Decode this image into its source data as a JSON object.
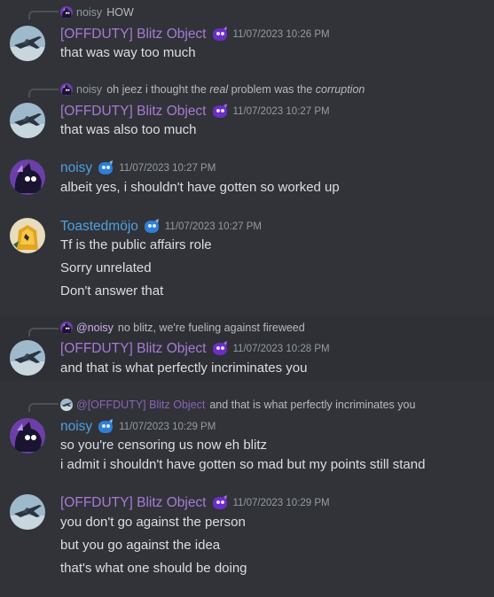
{
  "users": {
    "blitz": "[OFFDUTY] Blitz Object",
    "noisy": "noisy",
    "toast": "Toastedmöjo"
  },
  "messages": [
    {
      "reply": {
        "name": "noisy",
        "text": "HOW"
      },
      "author": "[OFFDUTY] Blitz Object",
      "timestamp": "11/07/2023 10:26 PM",
      "lines": [
        "that was way too much"
      ]
    },
    {
      "reply": {
        "name": "noisy",
        "text_pre": "oh jeez i thought the ",
        "text_em": "real",
        "text_mid": " problem was the ",
        "text_em2": "corruption"
      },
      "author": "[OFFDUTY] Blitz Object",
      "timestamp": "11/07/2023 10:27 PM",
      "lines": [
        "that was also too much"
      ]
    },
    {
      "author": "noisy",
      "timestamp": "11/07/2023 10:27 PM",
      "lines": [
        "albeit yes, i shouldn't have gotten so worked up"
      ]
    },
    {
      "author": "Toastedmöjo",
      "timestamp": "11/07/2023 10:27 PM",
      "lines": [
        "Tf is the public affairs role",
        "Sorry unrelated",
        "Don't answer that"
      ]
    },
    {
      "reply": {
        "name": "@noisy",
        "text": "no blitz, we're fueling against fireweed"
      },
      "author": "[OFFDUTY] Blitz Object",
      "timestamp": "11/07/2023 10:28 PM",
      "lines": [
        "and that is what perfectly incriminates you"
      ]
    },
    {
      "reply": {
        "name": "@[OFFDUTY] Blitz Object",
        "text": "and that is what perfectly incriminates you"
      },
      "author": "noisy",
      "timestamp": "11/07/2023 10:29 PM",
      "lines": [
        "so you're censoring us now eh blitz",
        "i admit i shouldn't have gotten so mad but my points still stand"
      ]
    },
    {
      "author": "[OFFDUTY] Blitz Object",
      "timestamp": "11/07/2023 10:29 PM",
      "lines": [
        "you don't go against the person",
        "but you go against the idea",
        "that's what one should be doing"
      ]
    }
  ],
  "colors": {
    "background": "#313338",
    "blitz_name": "#a77ad7",
    "noisy_name": "#4da0e0",
    "text": "#dbdee1",
    "muted": "#949ba4"
  },
  "icons": [
    "jet-avatar-icon",
    "purple-creature-avatar-icon",
    "toast-avatar-icon",
    "role-badge-icon"
  ]
}
